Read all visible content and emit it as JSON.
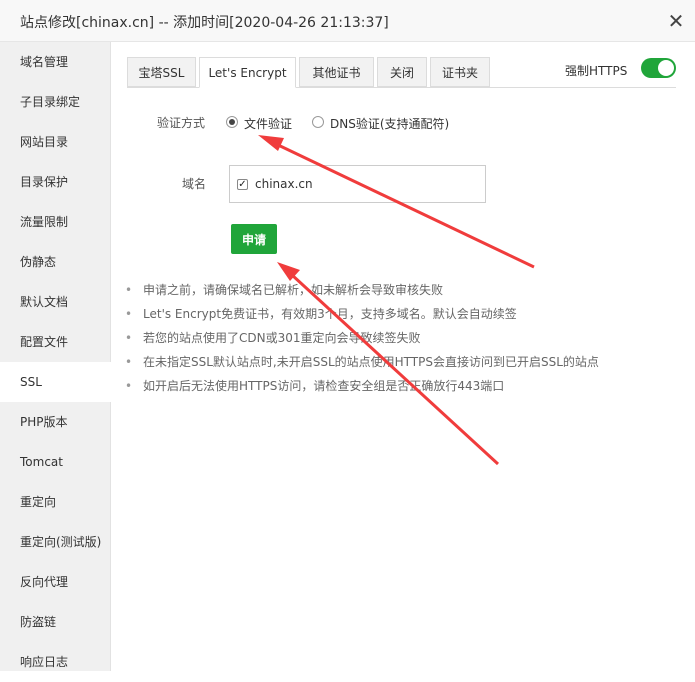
{
  "window": {
    "title": "站点修改[chinax.cn] -- 添加时间[2020-04-26 21:13:37]",
    "close_symbol": "✕"
  },
  "sidebar": {
    "items": [
      {
        "label": "域名管理"
      },
      {
        "label": "子目录绑定"
      },
      {
        "label": "网站目录"
      },
      {
        "label": "目录保护"
      },
      {
        "label": "流量限制"
      },
      {
        "label": "伪静态"
      },
      {
        "label": "默认文档"
      },
      {
        "label": "配置文件"
      },
      {
        "label": "SSL",
        "active": true
      },
      {
        "label": "PHP版本"
      },
      {
        "label": "Tomcat"
      },
      {
        "label": "重定向"
      },
      {
        "label": "重定向(测试版)"
      },
      {
        "label": "反向代理"
      },
      {
        "label": "防盗链"
      },
      {
        "label": "响应日志"
      }
    ]
  },
  "tabs": [
    {
      "label": "宝塔SSL"
    },
    {
      "label": "Let's Encrypt",
      "active": true
    },
    {
      "label": "其他证书"
    },
    {
      "label": "关闭"
    },
    {
      "label": "证书夹"
    }
  ],
  "force_https": {
    "label": "强制HTTPS",
    "enabled": true
  },
  "verify": {
    "label": "验证方式",
    "options": [
      {
        "label": "文件验证",
        "checked": true
      },
      {
        "label": "DNS验证(支持通配符)",
        "checked": false
      }
    ]
  },
  "domain": {
    "label": "域名",
    "items": [
      {
        "name": "chinax.cn",
        "checked": true,
        "check_mark": "✓"
      }
    ]
  },
  "apply_button": {
    "label": "申请"
  },
  "notes": [
    "申请之前，请确保域名已解析，如未解析会导致审核失败",
    "Let's Encrypt免费证书，有效期3个月，支持多域名。默认会自动续签",
    "若您的站点使用了CDN或301重定向会导致续签失败",
    "在未指定SSL默认站点时,未开启SSL的站点使用HTTPS会直接访问到已开启SSL的站点",
    "如开启后无法使用HTTPS访问，请检查安全组是否正确放行443端口"
  ],
  "colors": {
    "accent": "#20a53a",
    "annotation_arrow": "#f03c3c"
  }
}
